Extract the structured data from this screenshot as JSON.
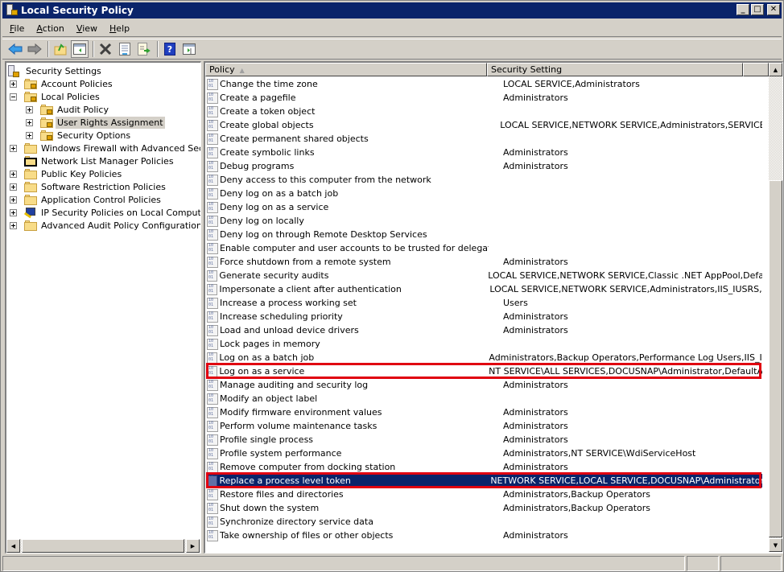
{
  "window": {
    "title": "Local Security Policy",
    "controls": {
      "minimize": "_",
      "maximize": "□",
      "close": "✕"
    }
  },
  "menu": [
    {
      "label": "File",
      "accel": "F"
    },
    {
      "label": "Action",
      "accel": "A"
    },
    {
      "label": "View",
      "accel": "V"
    },
    {
      "label": "Help",
      "accel": "H"
    }
  ],
  "toolbar": {
    "buttons": [
      {
        "name": "back-button",
        "icon": "arrow-left-icon",
        "glyph": "⬅"
      },
      {
        "name": "forward-button",
        "icon": "arrow-right-icon",
        "glyph": "➡"
      },
      {
        "name": "up-one-level-button",
        "icon": "folder-up-icon",
        "glyph": "📁"
      },
      {
        "name": "show-hide-console-tree-button",
        "icon": "console-tree-icon",
        "glyph": "▤"
      },
      {
        "name": "delete-button",
        "icon": "delete-x-icon",
        "glyph": "✖"
      },
      {
        "name": "properties-button",
        "icon": "properties-icon",
        "glyph": "▦"
      },
      {
        "name": "export-list-button",
        "icon": "export-list-icon",
        "glyph": "⇨"
      },
      {
        "name": "help-button",
        "icon": "help-icon",
        "glyph": "?"
      },
      {
        "name": "show-hide-action-pane-button",
        "icon": "action-pane-icon",
        "glyph": "▥"
      }
    ]
  },
  "tree": {
    "root": "Security Settings",
    "items": [
      {
        "label": "Account Policies",
        "level": 1,
        "expander": "plus",
        "icon": "locked-folder"
      },
      {
        "label": "Local Policies",
        "level": 1,
        "expander": "minus",
        "icon": "locked-folder"
      },
      {
        "label": "Audit Policy",
        "level": 2,
        "expander": "plus",
        "icon": "locked-folder"
      },
      {
        "label": "User Rights Assignment",
        "level": 2,
        "expander": "plus",
        "icon": "locked-folder",
        "selected": true
      },
      {
        "label": "Security Options",
        "level": 2,
        "expander": "plus",
        "icon": "locked-folder"
      },
      {
        "label": "Windows Firewall with Advanced Security",
        "level": 1,
        "expander": "plus",
        "icon": "folder"
      },
      {
        "label": "Network List Manager Policies",
        "level": 1,
        "expander": "none",
        "icon": "folder"
      },
      {
        "label": "Public Key Policies",
        "level": 1,
        "expander": "plus",
        "icon": "folder"
      },
      {
        "label": "Software Restriction Policies",
        "level": 1,
        "expander": "plus",
        "icon": "folder"
      },
      {
        "label": "Application Control Policies",
        "level": 1,
        "expander": "plus",
        "icon": "folder"
      },
      {
        "label": "IP Security Policies on Local Computer",
        "level": 1,
        "expander": "plus",
        "icon": "ipsec"
      },
      {
        "label": "Advanced Audit Policy Configuration",
        "level": 1,
        "expander": "plus",
        "icon": "folder"
      }
    ]
  },
  "list": {
    "columns": [
      {
        "label": "Policy",
        "sorted": "ascending"
      },
      {
        "label": "Security Setting"
      }
    ],
    "rows": [
      {
        "policy": "Change the time zone",
        "setting": "LOCAL SERVICE,Administrators"
      },
      {
        "policy": "Create a pagefile",
        "setting": "Administrators"
      },
      {
        "policy": "Create a token object",
        "setting": ""
      },
      {
        "policy": "Create global objects",
        "setting": "LOCAL SERVICE,NETWORK SERVICE,Administrators,SERVICE"
      },
      {
        "policy": "Create permanent shared objects",
        "setting": ""
      },
      {
        "policy": "Create symbolic links",
        "setting": "Administrators"
      },
      {
        "policy": "Debug programs",
        "setting": "Administrators"
      },
      {
        "policy": "Deny access to this computer from the network",
        "setting": ""
      },
      {
        "policy": "Deny log on as a batch job",
        "setting": ""
      },
      {
        "policy": "Deny log on as a service",
        "setting": ""
      },
      {
        "policy": "Deny log on locally",
        "setting": ""
      },
      {
        "policy": "Deny log on through Remote Desktop Services",
        "setting": ""
      },
      {
        "policy": "Enable computer and user accounts to be trusted for delegation",
        "setting": ""
      },
      {
        "policy": "Force shutdown from a remote system",
        "setting": "Administrators"
      },
      {
        "policy": "Generate security audits",
        "setting": "LOCAL SERVICE,NETWORK SERVICE,Classic .NET AppPool,Defau..."
      },
      {
        "policy": "Impersonate a client after authentication",
        "setting": "LOCAL SERVICE,NETWORK SERVICE,Administrators,IIS_IUSRS,S..."
      },
      {
        "policy": "Increase a process working set",
        "setting": "Users"
      },
      {
        "policy": "Increase scheduling priority",
        "setting": "Administrators"
      },
      {
        "policy": "Load and unload device drivers",
        "setting": "Administrators"
      },
      {
        "policy": "Lock pages in memory",
        "setting": ""
      },
      {
        "policy": "Log on as a batch job",
        "setting": "Administrators,Backup Operators,Performance Log Users,IIS_IU..."
      },
      {
        "policy": "Log on as a service",
        "setting": "NT SERVICE\\ALL SERVICES,DOCUSNAP\\Administrator,DefaultAp...",
        "highlighted": true
      },
      {
        "policy": "Manage auditing and security log",
        "setting": "Administrators"
      },
      {
        "policy": "Modify an object label",
        "setting": ""
      },
      {
        "policy": "Modify firmware environment values",
        "setting": "Administrators"
      },
      {
        "policy": "Perform volume maintenance tasks",
        "setting": "Administrators"
      },
      {
        "policy": "Profile single process",
        "setting": "Administrators"
      },
      {
        "policy": "Profile system performance",
        "setting": "Administrators,NT SERVICE\\WdiServiceHost"
      },
      {
        "policy": "Remove computer from docking station",
        "setting": "Administrators"
      },
      {
        "policy": "Replace a process level token",
        "setting": "NETWORK SERVICE,LOCAL SERVICE,DOCUSNAP\\Administrator,...",
        "highlighted": true,
        "selected": true
      },
      {
        "policy": "Restore files and directories",
        "setting": "Administrators,Backup Operators"
      },
      {
        "policy": "Shut down the system",
        "setting": "Administrators,Backup Operators"
      },
      {
        "policy": "Synchronize directory service data",
        "setting": ""
      },
      {
        "policy": "Take ownership of files or other objects",
        "setting": "Administrators"
      }
    ]
  },
  "scrollbars": {
    "list_vertical_position": "bottom",
    "tree_horizontal_position": "left"
  },
  "status": [
    "",
    "",
    ""
  ],
  "colors": {
    "titlebar": "#0a246a",
    "selection": "#0a246a",
    "highlight_box": "#e00010",
    "chrome": "#d4d0c8"
  }
}
